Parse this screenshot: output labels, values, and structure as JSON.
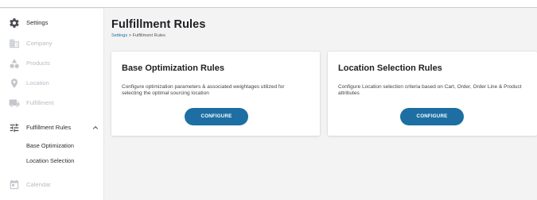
{
  "sidebar": {
    "items": [
      {
        "label": "Settings",
        "icon": "gear-icon",
        "state": "active"
      },
      {
        "label": "Company",
        "icon": "company-icon",
        "state": "disabled"
      },
      {
        "label": "Products",
        "icon": "products-icon",
        "state": "disabled"
      },
      {
        "label": "Location",
        "icon": "location-pin-icon",
        "state": "disabled"
      },
      {
        "label": "Fulfillment",
        "icon": "truck-icon",
        "state": "disabled"
      },
      {
        "label": "Fulfillment Rules",
        "icon": "sliders-icon",
        "state": "expanded"
      },
      {
        "label": "Calendar",
        "icon": "calendar-icon",
        "state": "disabled"
      }
    ],
    "sub_items": [
      {
        "label": "Base Optimization"
      },
      {
        "label": "Location Selection"
      }
    ]
  },
  "page": {
    "title": "Fulfillment Rules",
    "breadcrumb": {
      "root": "Settings",
      "separator": ">",
      "current": "Fulfillment Rules"
    }
  },
  "cards": [
    {
      "title": "Base Optimization Rules",
      "description": "Configure optimization parameters & associated weightages utilized for selecting the optimal sourcing location",
      "button": "CONFIGURE"
    },
    {
      "title": "Location Selection Rules",
      "description": "Configure Location selection criteria based on Cart, Order, Order Line & Product attributes",
      "button": "CONFIGURE"
    }
  ],
  "colors": {
    "accent": "#1d6fa3",
    "disabled_text": "#b8bcc2",
    "icon_dark": "#4a4d52",
    "icon_disabled": "#c3c7cc",
    "background": "#f3f3f4"
  }
}
